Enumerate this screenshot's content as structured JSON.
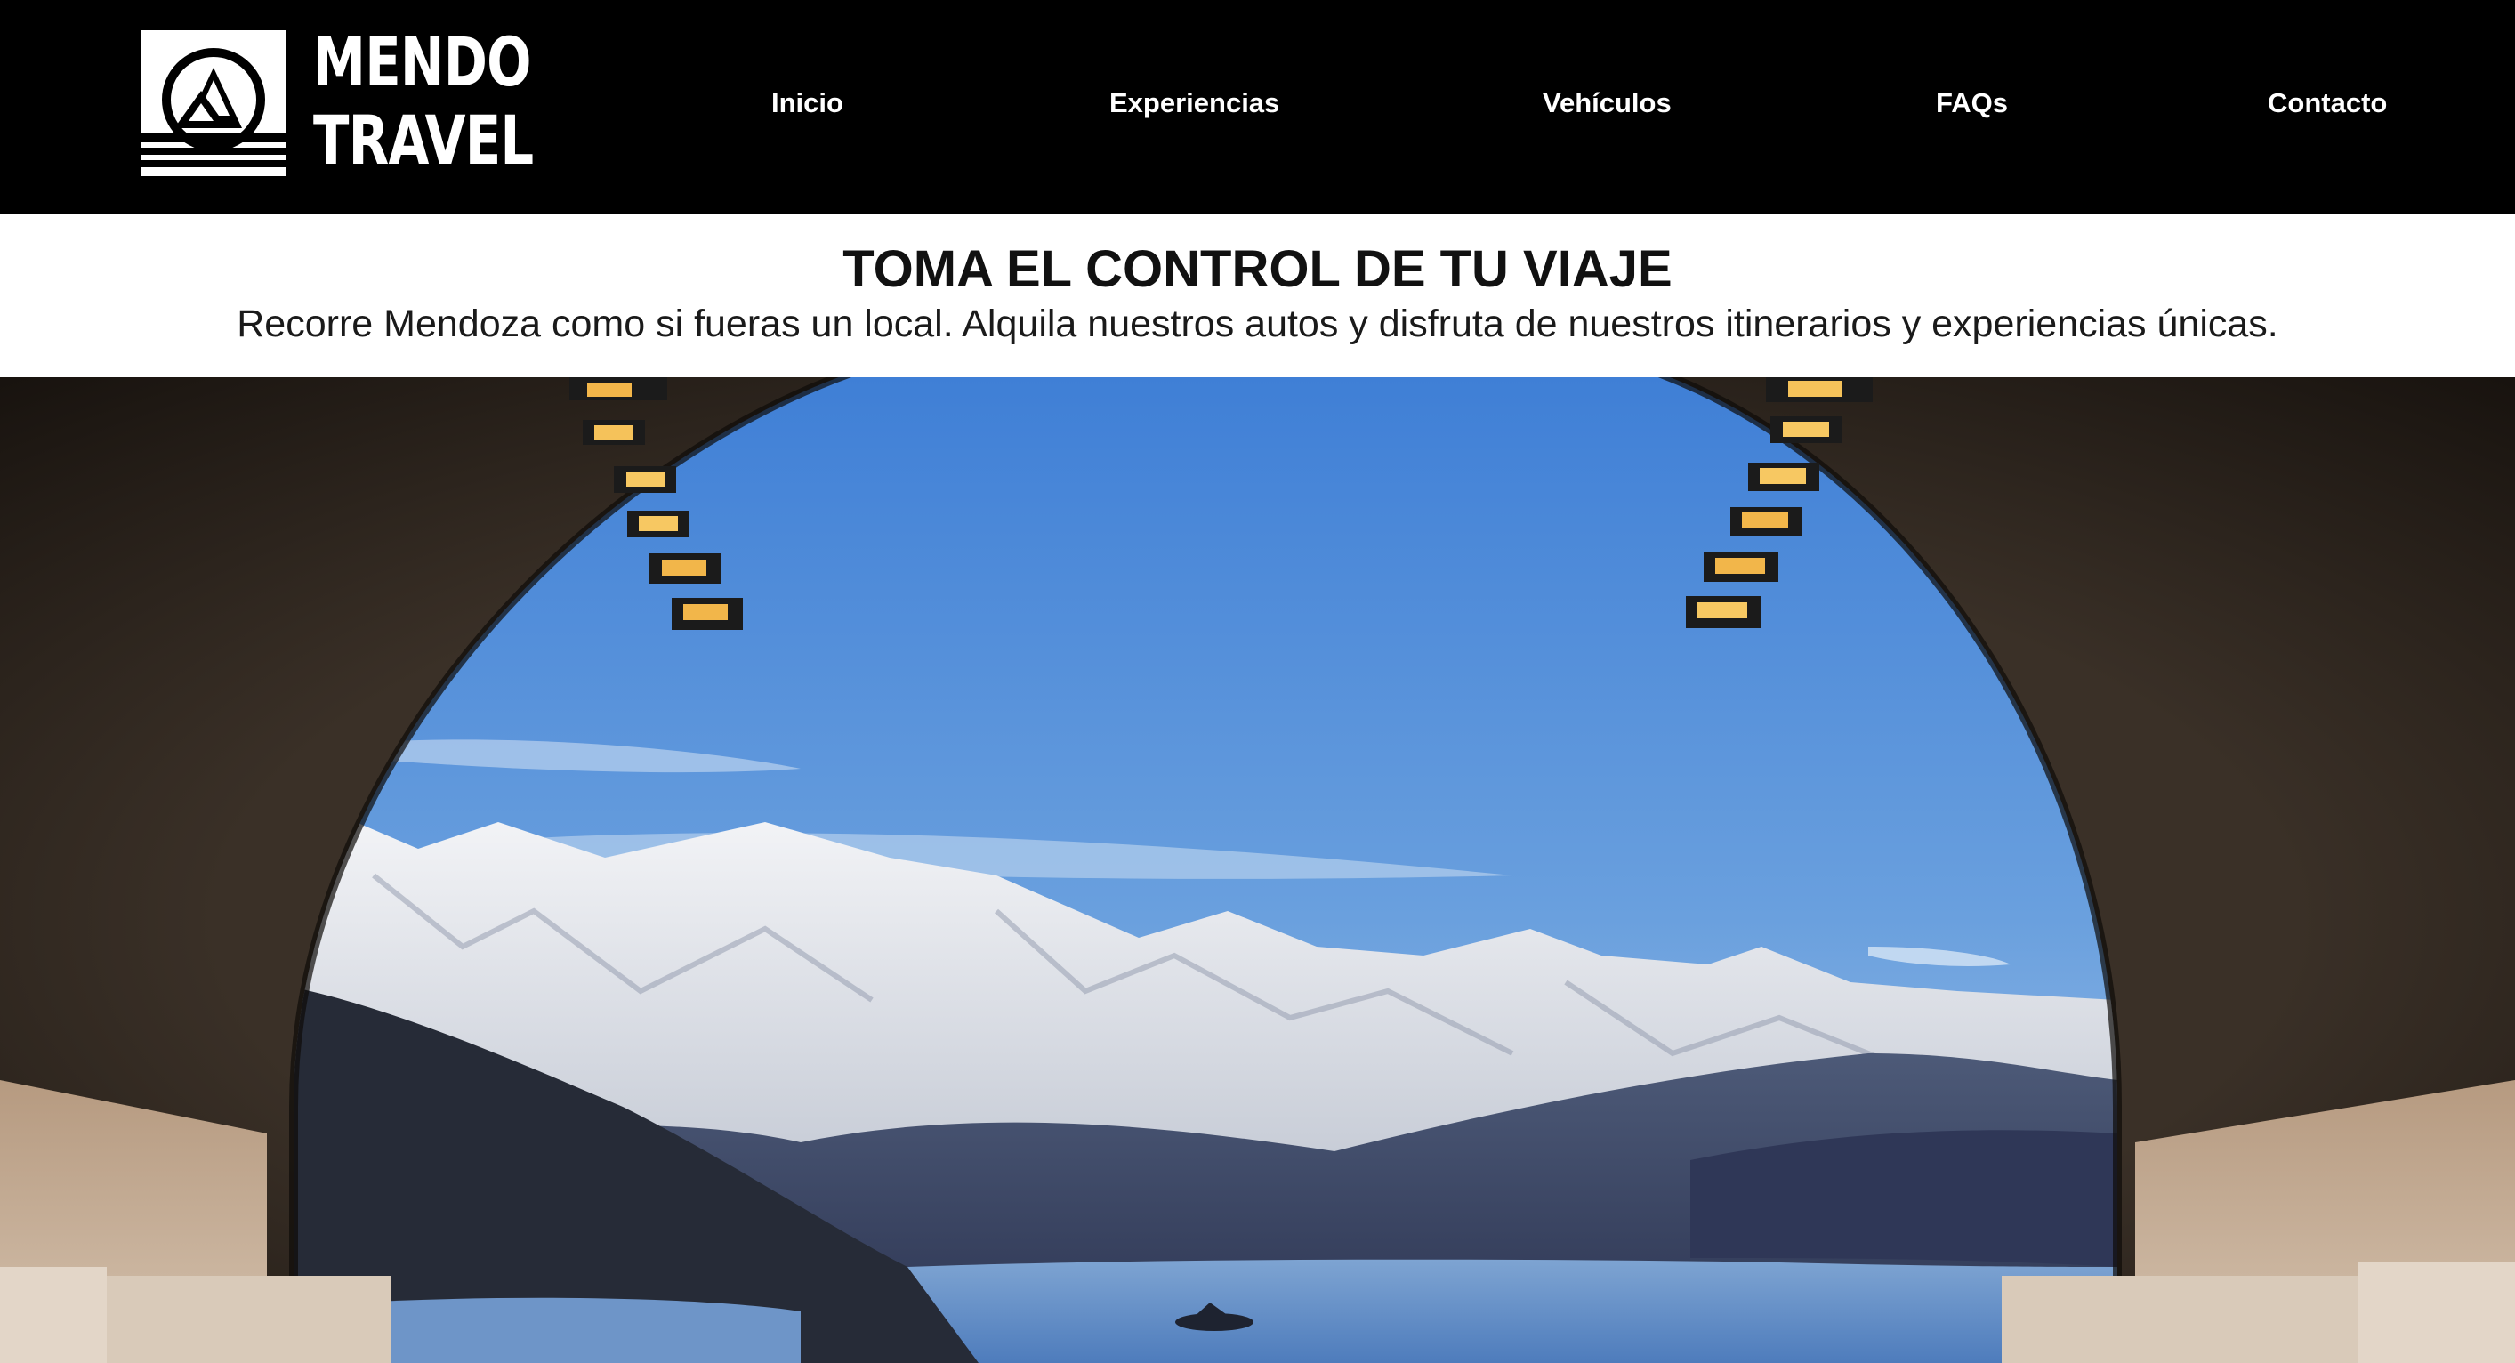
{
  "brand": {
    "line1": "MENDO",
    "line2": "TRAVEL",
    "icon": "mountain-circle-logo-icon"
  },
  "nav": {
    "items": [
      {
        "label": "Inicio"
      },
      {
        "label": "Experiencias"
      },
      {
        "label": "Vehículos"
      },
      {
        "label": "FAQs"
      },
      {
        "label": "Contacto"
      }
    ]
  },
  "intro": {
    "title": "TOMA EL CONTROL DE TU VIAJE",
    "subtitle": "Recorre Mendoza como si fueras un local. Alquila nuestros autos y disfruta de nuestros itinerarios y experiencias únicas."
  },
  "colors": {
    "header_bg": "#000000",
    "header_text": "#ffffff",
    "page_bg": "#ffffff",
    "sky": "#4a86d4",
    "tunnel": "#2a231d",
    "lake": "#5f8bc4"
  }
}
